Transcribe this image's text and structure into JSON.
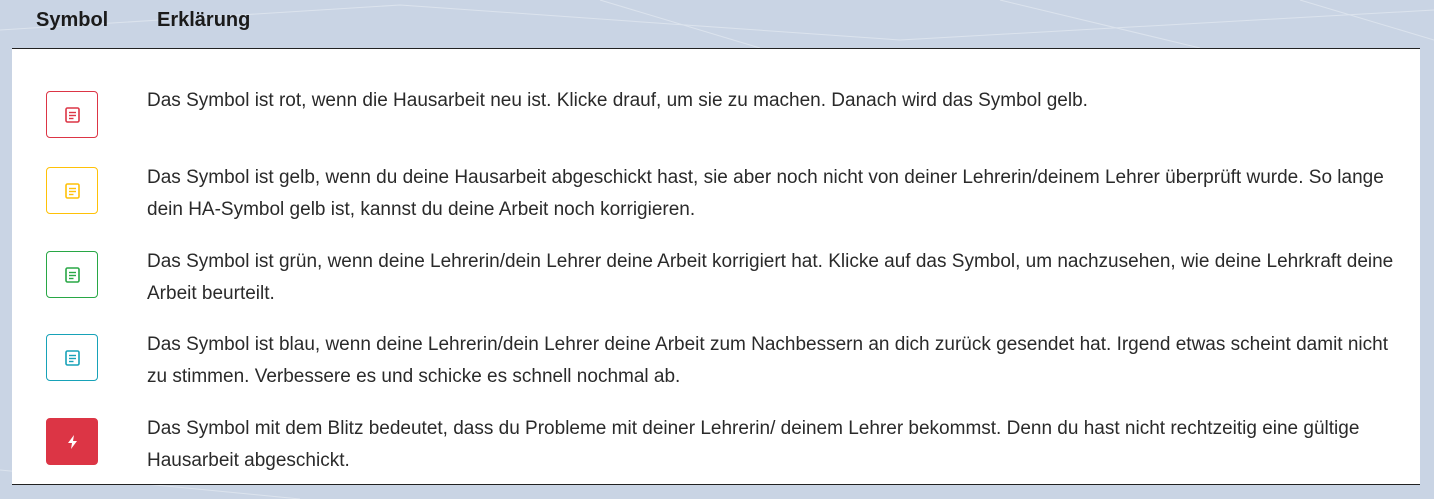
{
  "header": {
    "symbol_col": "Symbol",
    "explanation_col": "Erklärung"
  },
  "rows": [
    {
      "icon": "homework-icon",
      "color": "#dc3545",
      "text": "Das Symbol ist rot, wenn die Hausarbeit neu ist. Klicke drauf, um sie zu machen. Danach wird das Symbol gelb."
    },
    {
      "icon": "homework-icon",
      "color": "#ffc107",
      "text": "Das Symbol ist gelb, wenn du deine Hausarbeit abgeschickt hast, sie aber noch nicht von deiner Lehrerin/deinem Lehrer überprüft wurde. So lange dein HA-Symbol gelb ist, kannst du deine Arbeit noch korrigieren."
    },
    {
      "icon": "homework-icon",
      "color": "#28a745",
      "text": "Das Symbol ist grün, wenn deine Lehrerin/dein Lehrer deine Arbeit korrigiert hat. Klicke auf das Symbol, um nachzusehen, wie deine Lehrkraft deine Arbeit beurteilt."
    },
    {
      "icon": "homework-icon",
      "color": "#17a2b8",
      "text": "Das Symbol ist blau, wenn deine Lehrerin/dein Lehrer deine Arbeit zum Nachbessern an dich zurück gesendet hat. Irgend etwas scheint damit nicht zu stimmen. Verbessere es und schicke es schnell nochmal ab."
    },
    {
      "icon": "lightning-icon",
      "color": "#dc3545",
      "text": "Das Symbol mit dem Blitz bedeutet, dass du Probleme mit deiner Lehrerin/ deinem Lehrer bekommst. Denn du hast nicht rechtzeitig eine gültige Hausarbeit abgeschickt."
    }
  ]
}
